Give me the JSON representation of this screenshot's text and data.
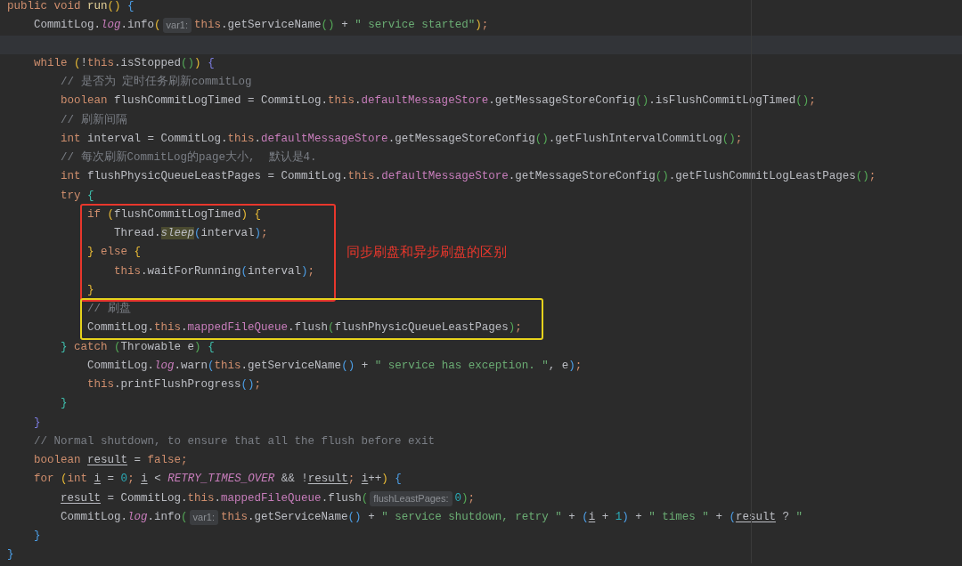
{
  "editor": {
    "lines": [
      {
        "kind": "line",
        "current": false,
        "segments": [
          {
            "kind": "code",
            "tokens": [
              {
                "kind": "kw",
                "text": "public void "
              },
              {
                "kind": "fn",
                "text": "run"
              },
              {
                "kind": "y",
                "text": "()"
              },
              {
                "kind": "b",
                "text": " {"
              }
            ]
          }
        ]
      },
      {
        "kind": "line",
        "current": false,
        "segments": [
          {
            "kind": "code",
            "tokens": [
              {
                "kind": "pl",
                "text": "    CommitLog."
              },
              {
                "kind": "st",
                "text": "log"
              },
              {
                "kind": "pl",
                "text": ".info"
              },
              {
                "kind": "y",
                "text": "("
              }
            ]
          },
          {
            "kind": "hint",
            "text": "var1:"
          },
          {
            "kind": "code",
            "tokens": [
              {
                "kind": "kw",
                "text": "this"
              },
              {
                "kind": "pl",
                "text": ".getServiceName"
              },
              {
                "kind": "g",
                "text": "()"
              },
              {
                "kind": "pl",
                "text": " + "
              },
              {
                "kind": "str",
                "text": "\" service started\""
              },
              {
                "kind": "y",
                "text": ")"
              },
              {
                "kind": "kw",
                "text": ";"
              }
            ]
          }
        ]
      },
      {
        "kind": "line",
        "current": true
      },
      {
        "kind": "line",
        "current": false,
        "segments": [
          {
            "kind": "code",
            "tokens": [
              {
                "kind": "kw",
                "text": "    while "
              },
              {
                "kind": "y",
                "text": "("
              },
              {
                "kind": "pl",
                "text": "!"
              },
              {
                "kind": "kw",
                "text": "this"
              },
              {
                "kind": "pl",
                "text": ".isStopped"
              },
              {
                "kind": "g",
                "text": "()"
              },
              {
                "kind": "y",
                "text": ")"
              },
              {
                "kind": "v",
                "text": " {"
              }
            ]
          }
        ]
      },
      {
        "kind": "line",
        "current": false,
        "segments": [
          {
            "kind": "code",
            "tokens": [
              {
                "kind": "cm",
                "text": "        // 是否为 定时任务刷新commitLog"
              }
            ]
          }
        ]
      },
      {
        "kind": "line",
        "current": false,
        "segments": [
          {
            "kind": "code",
            "tokens": [
              {
                "kind": "kw",
                "text": "        boolean "
              },
              {
                "kind": "pl",
                "text": "flushCommitLogTimed = CommitLog."
              },
              {
                "kind": "kw",
                "text": "this"
              },
              {
                "kind": "pl",
                "text": "."
              },
              {
                "kind": "fld",
                "text": "defaultMessageStore"
              },
              {
                "kind": "pl",
                "text": ".getMessageStoreConfig"
              },
              {
                "kind": "g",
                "text": "()"
              },
              {
                "kind": "pl",
                "text": ".isFlushCommitLogTimed"
              },
              {
                "kind": "g",
                "text": "()"
              },
              {
                "kind": "kw",
                "text": ";"
              }
            ]
          }
        ]
      },
      {
        "kind": "line",
        "current": false,
        "segments": [
          {
            "kind": "code",
            "tokens": [
              {
                "kind": "cm",
                "text": "        // 刷新间隔"
              }
            ]
          }
        ]
      },
      {
        "kind": "line",
        "current": false,
        "segments": [
          {
            "kind": "code",
            "tokens": [
              {
                "kind": "kw",
                "text": "        int "
              },
              {
                "kind": "pl",
                "text": "interval = CommitLog."
              },
              {
                "kind": "kw",
                "text": "this"
              },
              {
                "kind": "pl",
                "text": "."
              },
              {
                "kind": "fld",
                "text": "defaultMessageStore"
              },
              {
                "kind": "pl",
                "text": ".getMessageStoreConfig"
              },
              {
                "kind": "g",
                "text": "()"
              },
              {
                "kind": "pl",
                "text": ".getFlushIntervalCommitLog"
              },
              {
                "kind": "g",
                "text": "()"
              },
              {
                "kind": "kw",
                "text": ";"
              }
            ]
          }
        ]
      },
      {
        "kind": "line",
        "current": false,
        "segments": [
          {
            "kind": "code",
            "tokens": [
              {
                "kind": "cm",
                "text": "        // 每次刷新CommitLog的page大小,  默认是4."
              }
            ]
          }
        ]
      },
      {
        "kind": "line",
        "current": false,
        "segments": [
          {
            "kind": "code",
            "tokens": [
              {
                "kind": "kw",
                "text": "        int "
              },
              {
                "kind": "pl",
                "text": "flushPhysicQueueLeastPages = CommitLog."
              },
              {
                "kind": "kw",
                "text": "this"
              },
              {
                "kind": "pl",
                "text": "."
              },
              {
                "kind": "fld",
                "text": "defaultMessageStore"
              },
              {
                "kind": "pl",
                "text": ".getMessageStoreConfig"
              },
              {
                "kind": "g",
                "text": "()"
              },
              {
                "kind": "pl",
                "text": ".getFlushCommitLogLeastPages"
              },
              {
                "kind": "g",
                "text": "()"
              },
              {
                "kind": "kw",
                "text": ";"
              }
            ]
          }
        ]
      },
      {
        "kind": "line",
        "current": false,
        "segments": [
          {
            "kind": "code",
            "tokens": [
              {
                "kind": "kw",
                "text": "        try "
              },
              {
                "kind": "t",
                "text": "{"
              }
            ]
          }
        ]
      },
      {
        "kind": "box",
        "color": "#e8372c",
        "note": "同步刷盘和异步刷盘的区别",
        "lines": [
          {
            "kind": "line",
            "current": false,
            "segments": [
              {
                "kind": "code",
                "tokens": [
                  {
                    "kind": "kw",
                    "text": "            if "
                  },
                  {
                    "kind": "y",
                    "text": "("
                  },
                  {
                    "kind": "pl",
                    "text": "flushCommitLogTimed"
                  },
                  {
                    "kind": "y",
                    "text": ") {"
                  }
                ]
              }
            ]
          },
          {
            "kind": "line",
            "current": false,
            "segments": [
              {
                "kind": "code",
                "tokens": [
                  {
                    "kind": "pl",
                    "text": "                Thread."
                  },
                  {
                    "kind": "hl",
                    "text": "sleep"
                  },
                  {
                    "kind": "b",
                    "text": "("
                  },
                  {
                    "kind": "pl",
                    "text": "interval"
                  },
                  {
                    "kind": "b",
                    "text": ")"
                  },
                  {
                    "kind": "kw",
                    "text": ";"
                  }
                ]
              }
            ]
          },
          {
            "kind": "line",
            "current": false,
            "segments": [
              {
                "kind": "code",
                "tokens": [
                  {
                    "kind": "y",
                    "text": "            }"
                  },
                  {
                    "kind": "kw",
                    "text": " else "
                  },
                  {
                    "kind": "y",
                    "text": "{"
                  }
                ]
              }
            ]
          },
          {
            "kind": "line",
            "current": false,
            "segments": [
              {
                "kind": "code",
                "tokens": [
                  {
                    "kind": "kw",
                    "text": "                this"
                  },
                  {
                    "kind": "pl",
                    "text": ".waitForRunning"
                  },
                  {
                    "kind": "b",
                    "text": "("
                  },
                  {
                    "kind": "pl",
                    "text": "interval"
                  },
                  {
                    "kind": "b",
                    "text": ")"
                  },
                  {
                    "kind": "kw",
                    "text": ";"
                  }
                ]
              }
            ]
          },
          {
            "kind": "line",
            "current": false,
            "segments": [
              {
                "kind": "code",
                "tokens": [
                  {
                    "kind": "y",
                    "text": "            }"
                  }
                ]
              }
            ]
          }
        ]
      },
      {
        "kind": "box",
        "color": "#e6d21c",
        "lines": [
          {
            "kind": "line",
            "current": false,
            "segments": [
              {
                "kind": "code",
                "tokens": [
                  {
                    "kind": "cm",
                    "text": "            // 刷盘"
                  }
                ]
              }
            ]
          },
          {
            "kind": "line",
            "current": false,
            "segments": [
              {
                "kind": "code",
                "tokens": [
                  {
                    "kind": "pl",
                    "text": "            CommitLog."
                  },
                  {
                    "kind": "kw",
                    "text": "this"
                  },
                  {
                    "kind": "pl",
                    "text": "."
                  },
                  {
                    "kind": "fld",
                    "text": "mappedFileQueue"
                  },
                  {
                    "kind": "pl",
                    "text": ".flush"
                  },
                  {
                    "kind": "g",
                    "text": "("
                  },
                  {
                    "kind": "pl",
                    "text": "flushPhysicQueueLeastPages"
                  },
                  {
                    "kind": "g",
                    "text": ")"
                  },
                  {
                    "kind": "kw",
                    "text": ";"
                  }
                ]
              }
            ]
          }
        ]
      },
      {
        "kind": "line",
        "current": false,
        "segments": [
          {
            "kind": "code",
            "tokens": [
              {
                "kind": "t",
                "text": "        }"
              },
              {
                "kind": "kw",
                "text": " catch "
              },
              {
                "kind": "g",
                "text": "("
              },
              {
                "kind": "pl",
                "text": "Throwable e"
              },
              {
                "kind": "g",
                "text": ")"
              },
              {
                "kind": "t",
                "text": " {"
              }
            ]
          }
        ]
      },
      {
        "kind": "line",
        "current": false,
        "segments": [
          {
            "kind": "code",
            "tokens": [
              {
                "kind": "pl",
                "text": "            CommitLog."
              },
              {
                "kind": "st",
                "text": "log"
              },
              {
                "kind": "pl",
                "text": ".warn"
              },
              {
                "kind": "b",
                "text": "("
              },
              {
                "kind": "kw",
                "text": "this"
              },
              {
                "kind": "pl",
                "text": ".getServiceName"
              },
              {
                "kind": "b",
                "text": "()"
              },
              {
                "kind": "pl",
                "text": " + "
              },
              {
                "kind": "str",
                "text": "\" service has exception. \""
              },
              {
                "kind": "pl",
                "text": ", e"
              },
              {
                "kind": "b",
                "text": ")"
              },
              {
                "kind": "kw",
                "text": ";"
              }
            ]
          }
        ]
      },
      {
        "kind": "line",
        "current": false,
        "segments": [
          {
            "kind": "code",
            "tokens": [
              {
                "kind": "kw",
                "text": "            this"
              },
              {
                "kind": "pl",
                "text": ".printFlushProgress"
              },
              {
                "kind": "b",
                "text": "()"
              },
              {
                "kind": "kw",
                "text": ";"
              }
            ]
          }
        ]
      },
      {
        "kind": "line",
        "current": false,
        "segments": [
          {
            "kind": "code",
            "tokens": [
              {
                "kind": "t",
                "text": "        }"
              }
            ]
          }
        ]
      },
      {
        "kind": "line",
        "current": false,
        "segments": [
          {
            "kind": "code",
            "tokens": [
              {
                "kind": "v",
                "text": "    }"
              }
            ]
          }
        ]
      },
      {
        "kind": "line",
        "current": false,
        "segments": [
          {
            "kind": "code",
            "tokens": [
              {
                "kind": "cm",
                "text": "    // Normal shutdown, to ensure that all the flush before exit"
              }
            ]
          }
        ]
      },
      {
        "kind": "line",
        "current": false,
        "segments": [
          {
            "kind": "code",
            "tokens": [
              {
                "kind": "kw",
                "text": "    boolean "
              },
              {
                "kind": "ul",
                "text": "result"
              },
              {
                "kind": "pl",
                "text": " = "
              },
              {
                "kind": "kw",
                "text": "false;"
              }
            ]
          }
        ]
      },
      {
        "kind": "line",
        "current": false,
        "segments": [
          {
            "kind": "code",
            "tokens": [
              {
                "kind": "kw",
                "text": "    for "
              },
              {
                "kind": "y",
                "text": "("
              },
              {
                "kind": "kw",
                "text": "int "
              },
              {
                "kind": "ul",
                "text": "i"
              },
              {
                "kind": "pl",
                "text": " = "
              },
              {
                "kind": "num",
                "text": "0"
              },
              {
                "kind": "kw",
                "text": "; "
              },
              {
                "kind": "ul",
                "text": "i"
              },
              {
                "kind": "pl",
                "text": " < "
              },
              {
                "kind": "cst",
                "text": "RETRY_TIMES_OVER"
              },
              {
                "kind": "pl",
                "text": " && !"
              },
              {
                "kind": "ul",
                "text": "result"
              },
              {
                "kind": "kw",
                "text": "; "
              },
              {
                "kind": "ul",
                "text": "i"
              },
              {
                "kind": "pl",
                "text": "++"
              },
              {
                "kind": "y",
                "text": ")"
              },
              {
                "kind": "b",
                "text": " {"
              }
            ]
          }
        ]
      },
      {
        "kind": "line",
        "current": false,
        "segments": [
          {
            "kind": "code",
            "tokens": [
              {
                "kind": "ul",
                "text": "        result"
              },
              {
                "kind": "pl",
                "text": " = CommitLog."
              },
              {
                "kind": "kw",
                "text": "this"
              },
              {
                "kind": "pl",
                "text": "."
              },
              {
                "kind": "fld",
                "text": "mappedFileQueue"
              },
              {
                "kind": "pl",
                "text": ".flush"
              },
              {
                "kind": "g",
                "text": "("
              }
            ]
          },
          {
            "kind": "hint",
            "text": "flushLeastPages:"
          },
          {
            "kind": "code",
            "tokens": [
              {
                "kind": "num",
                "text": "0"
              },
              {
                "kind": "g",
                "text": ")"
              },
              {
                "kind": "kw",
                "text": ";"
              }
            ]
          }
        ]
      },
      {
        "kind": "line",
        "current": false,
        "segments": [
          {
            "kind": "code",
            "tokens": [
              {
                "kind": "pl",
                "text": "        CommitLog."
              },
              {
                "kind": "st",
                "text": "log"
              },
              {
                "kind": "pl",
                "text": ".info"
              },
              {
                "kind": "g",
                "text": "("
              }
            ]
          },
          {
            "kind": "hint",
            "text": "var1:"
          },
          {
            "kind": "code",
            "tokens": [
              {
                "kind": "kw",
                "text": "this"
              },
              {
                "kind": "pl",
                "text": ".getServiceName"
              },
              {
                "kind": "b",
                "text": "()"
              },
              {
                "kind": "pl",
                "text": " + "
              },
              {
                "kind": "str",
                "text": "\" service shutdown, retry \""
              },
              {
                "kind": "pl",
                "text": " + "
              },
              {
                "kind": "b",
                "text": "("
              },
              {
                "kind": "ul",
                "text": "i"
              },
              {
                "kind": "pl",
                "text": " + "
              },
              {
                "kind": "num",
                "text": "1"
              },
              {
                "kind": "b",
                "text": ")"
              },
              {
                "kind": "pl",
                "text": " + "
              },
              {
                "kind": "str",
                "text": "\" times \""
              },
              {
                "kind": "pl",
                "text": " + "
              },
              {
                "kind": "b",
                "text": "("
              },
              {
                "kind": "ul",
                "text": "result"
              },
              {
                "kind": "pl",
                "text": " ? "
              },
              {
                "kind": "str",
                "text": "\""
              }
            ]
          }
        ]
      },
      {
        "kind": "line",
        "current": false,
        "segments": [
          {
            "kind": "code",
            "tokens": [
              {
                "kind": "b",
                "text": "    }"
              }
            ]
          }
        ]
      },
      {
        "kind": "line",
        "current": false,
        "segments": [
          {
            "kind": "code",
            "tokens": [
              {
                "kind": "b",
                "text": "}"
              }
            ]
          }
        ]
      }
    ]
  }
}
